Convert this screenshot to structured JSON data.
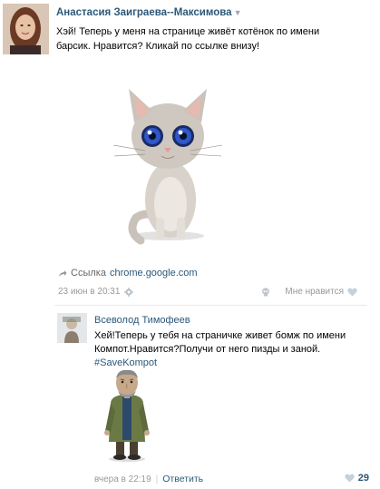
{
  "post": {
    "author": "Анастасия Заиграева--Максимова",
    "caret": "▼",
    "text_line1": "Хэй! Теперь у меня на странице живёт котёнок по имени",
    "text_line2": "барсик. Нравится? Кликай по ссылке внизу!",
    "link_label": "Ссылка",
    "link_url": "chrome.google.com",
    "time": "23 июн в 20:31",
    "like_label": "Мне нравится"
  },
  "comment": {
    "author": "Всеволод Тимофеев",
    "text_line1": "Хей!Теперь у тебя на страничке живет бомж по имени",
    "text_line2": "Компот.Нравится?Получи от него пизды и заной.",
    "hashtag": "#SaveKompot",
    "time": "вчера в 22:19",
    "separator": "|",
    "reply_label": "Ответить",
    "likes": "29"
  },
  "icons": {
    "link": "share-link-icon",
    "settings": "gear-icon",
    "skull": "skull-icon",
    "heart": "heart-icon"
  },
  "colors": {
    "link_blue": "#2b587a",
    "meta_gray": "#999999",
    "heart_gray": "#c5d0db"
  }
}
